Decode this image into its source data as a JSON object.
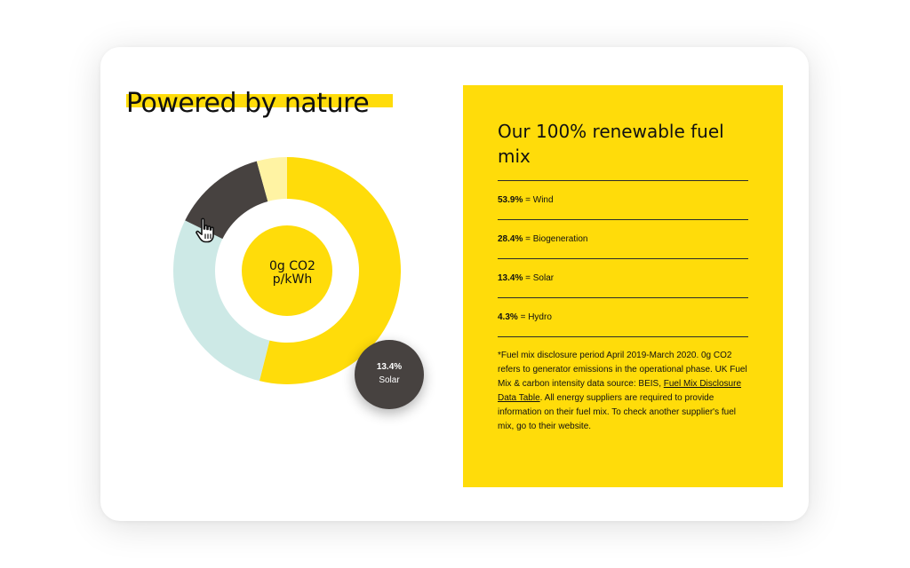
{
  "page": {
    "title": "Powered by nature",
    "center_label": [
      "0g CO2",
      "p/kWh"
    ],
    "tooltip": {
      "value": "13.4%",
      "name": "Solar"
    }
  },
  "panel": {
    "title": "Our 100% renewable fuel mix",
    "items": [
      {
        "pct": "53.9%",
        "sep": " = ",
        "name": "Wind"
      },
      {
        "pct": "28.4%",
        "sep": " = ",
        "name": "Biogeneration"
      },
      {
        "pct": "13.4%",
        "sep": " = ",
        "name": "Solar"
      },
      {
        "pct": "4.3%",
        "sep": " = ",
        "name": "Hydro"
      }
    ],
    "disclaimer": {
      "before": "*Fuel mix disclosure period April 2019-March 2020. 0g CO2 refers to generator emissions in the operational phase. UK Fuel Mix & carbon intensity data source: BEIS, ",
      "link": "Fuel Mix Disclosure Data Table",
      "after": ". All energy suppliers are required to provide information on their fuel mix. To check another supplier's fuel mix, go to their website."
    }
  },
  "colors": {
    "accent_yellow": "#FFDC0A",
    "wind": "#FFDC0A",
    "biogeneration": "#CDE9E6",
    "solar": "#474240",
    "hydro": "#FFF3A3",
    "center_circle": "#FFDC0A",
    "text": "#111111"
  },
  "icons": {
    "cursor": "hand-pointer-icon"
  },
  "chart_data": {
    "type": "pie",
    "variant": "donut",
    "categories": [
      "Wind",
      "Biogeneration",
      "Solar",
      "Hydro"
    ],
    "values": [
      53.9,
      28.4,
      13.4,
      4.3
    ],
    "unit": "%",
    "colors": [
      "#FFDC0A",
      "#CDE9E6",
      "#474240",
      "#FFF3A3"
    ],
    "start_at": "top",
    "direction": "clockwise",
    "highlighted": "Solar"
  }
}
